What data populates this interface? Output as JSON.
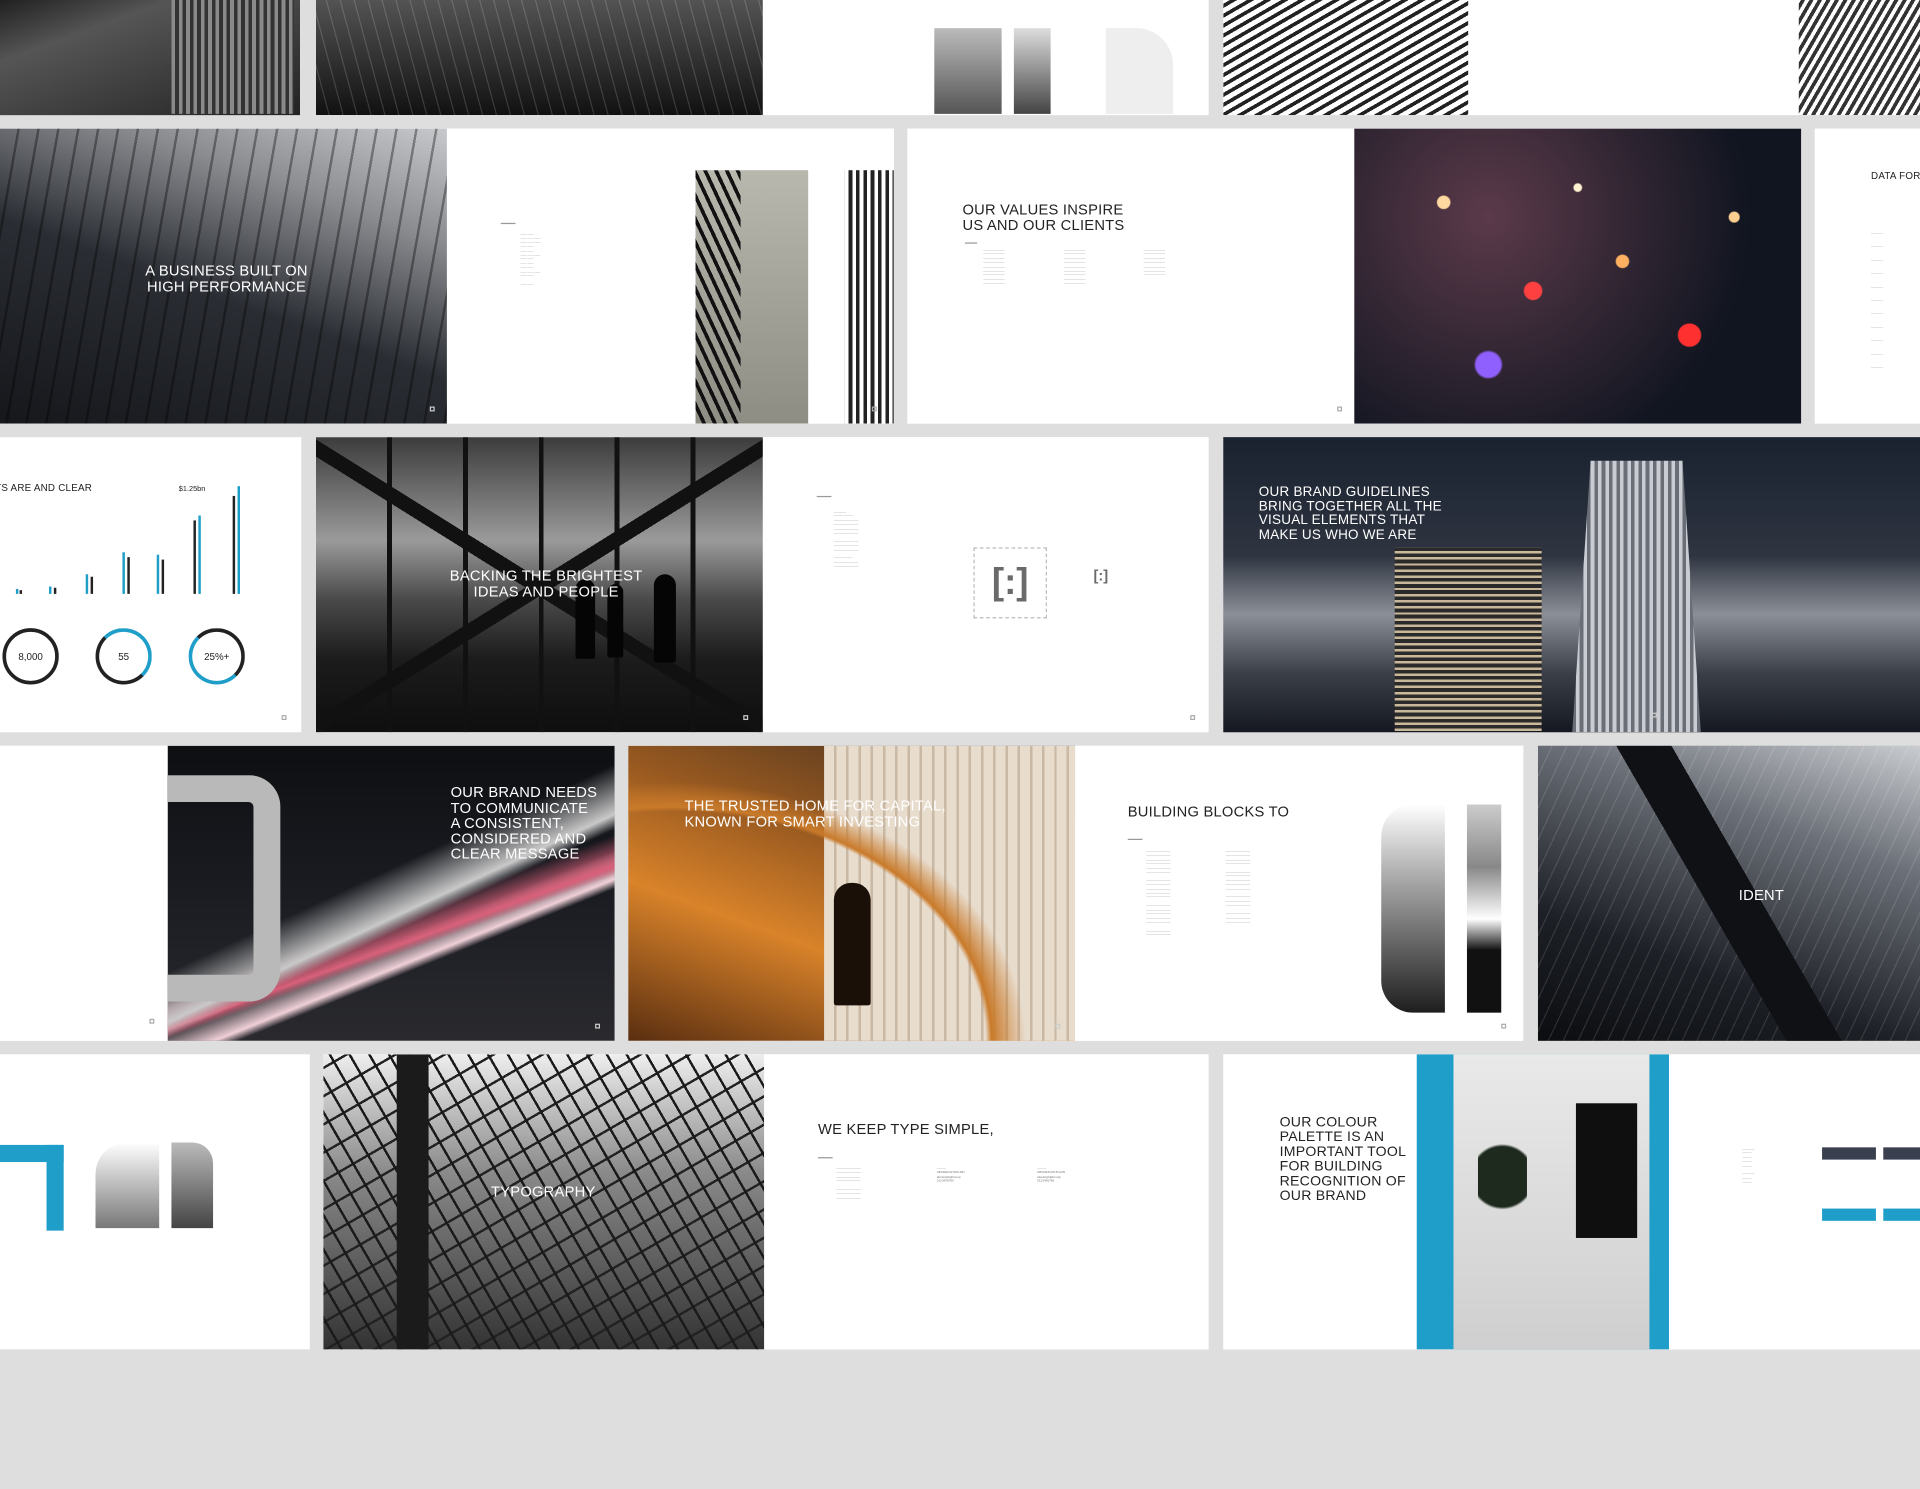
{
  "colors": {
    "accent": "#1e9ec8",
    "bg": "#dedede",
    "dark": "#1c1c1c"
  },
  "slides": {
    "s_business": "A BUSINESS BUILT ON HIGH PERFORMANCE",
    "s_values": "OUR VALUES INSPIRE US AND OUR CLIENTS",
    "s_data": "DATA FOR",
    "s_stats_title": "TS ARE AND CLEAR",
    "s_stats_value": "$1.25bn",
    "s_stat1": "8,000",
    "s_stat2": "55",
    "s_stat3": "25%+",
    "s_backing": "BACKING THE BRIGHTEST IDEAS AND PEOPLE",
    "s_guidelines": "OUR BRAND GUIDELINES BRING TOGETHER ALL THE VISUAL ELEMENTS THAT MAKE US WHO WE ARE",
    "s_communicate": "OUR BRAND NEEDS TO COMMUNICATE A CONSISTENT, CONSIDERED AND CLEAR MESSAGE",
    "s_trusted": "THE TRUSTED HOME FOR CAPITAL, KNOWN FOR SMART INVESTING",
    "s_blocks": "BUILDING BLOCKS TO",
    "s_ident": "IDENT",
    "s_typography": "TYPOGRAPHY",
    "s_type": "WE KEEP TYPE SIMPLE,",
    "s_colour": "OUR COLOUR PALETTE IS AN IMPORTANT TOOL FOR BUILDING RECOGNITION OF OUR BRAND"
  }
}
